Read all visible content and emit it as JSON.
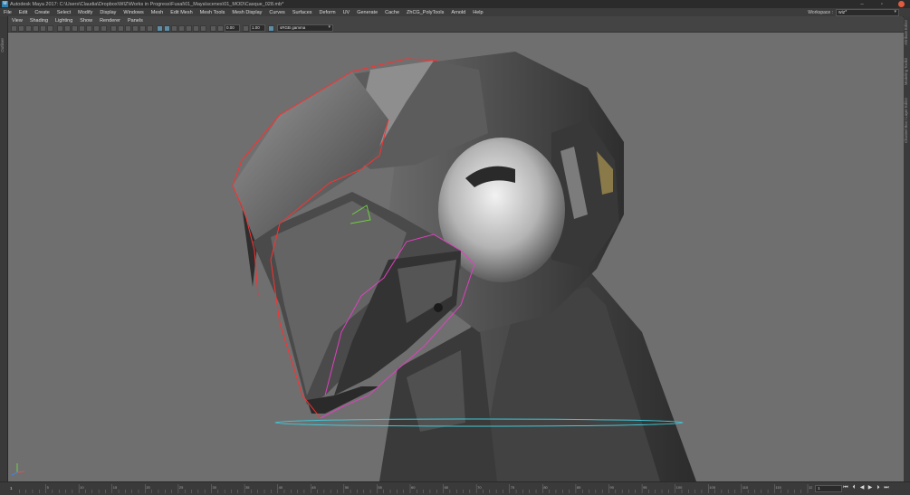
{
  "window": {
    "app_icon": "M",
    "title": "Autodesk Maya 2017: C:\\Users\\Claudia\\Dropbox\\WIZ\\Works in Progress\\Fusal\\01_Maya\\scenes\\01_MOD\\Casque_028.mb*"
  },
  "menus": [
    "File",
    "Edit",
    "Create",
    "Select",
    "Modify",
    "Display",
    "Windows",
    "Mesh",
    "Edit Mesh",
    "Mesh Tools",
    "Mesh Display",
    "Curves",
    "Surfaces",
    "Deform",
    "UV",
    "Generate",
    "Cache",
    "ZhCG_PolyTools",
    "Arnold",
    "Help"
  ],
  "workspace": {
    "label": "Workspace :",
    "value": "wiz*"
  },
  "panel_menus": [
    "View",
    "Shading",
    "Lighting",
    "Show",
    "Renderer",
    "Panels"
  ],
  "panel_toolbar": {
    "exposure": "0.00",
    "gamma": "1.00",
    "color_space": "sRGB gamma"
  },
  "side_tabs": {
    "left": "Outliner",
    "right": [
      "Attribute Editor",
      "Modeling Toolkit",
      "Channel Box / Layer Editor"
    ]
  },
  "timeline": {
    "start_frame": "1",
    "current_frame": "1",
    "tick_labels": [
      "5",
      "10",
      "15",
      "20",
      "25",
      "30",
      "35",
      "40",
      "45",
      "50",
      "55",
      "60",
      "65",
      "70",
      "75",
      "80",
      "85",
      "90",
      "95",
      "100",
      "105",
      "110",
      "115",
      "120"
    ]
  },
  "colors": {
    "viewport_bg": "#6f6f6f",
    "ui_dark": "#3c3c3c",
    "selection_magenta": "#e040c0",
    "selection_red": "#ff3030",
    "curve_cyan": "#40c8d8",
    "close_button": "#e25b3e"
  },
  "icons": {
    "close": "close-icon",
    "minimize": "minimize-icon",
    "maximize": "maximize-icon",
    "axis": "axis-gizmo-icon"
  }
}
